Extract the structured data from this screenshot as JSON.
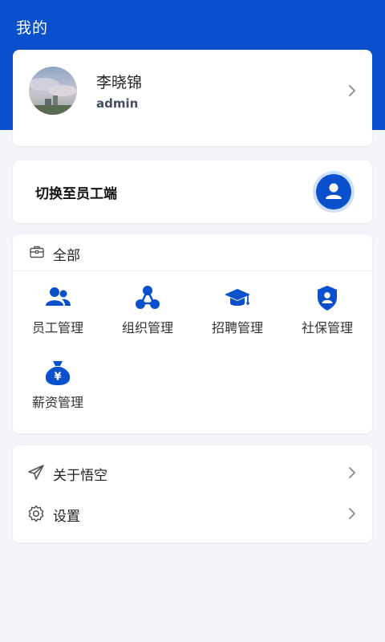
{
  "header": {
    "title": "我的",
    "background": "#0a4fcc"
  },
  "profile": {
    "name": "李晓锦",
    "account": "admin"
  },
  "switch": {
    "label": "切换至员工端"
  },
  "modules": {
    "title": "全部",
    "items": [
      {
        "label": "员工管理",
        "icon": "users-icon"
      },
      {
        "label": "组织管理",
        "icon": "org-structure-icon"
      },
      {
        "label": "招聘管理",
        "icon": "graduation-cap-icon"
      },
      {
        "label": "社保管理",
        "icon": "shield-user-icon"
      },
      {
        "label": "薪资管理",
        "icon": "money-bag-icon"
      }
    ]
  },
  "links": [
    {
      "label": "关于悟空",
      "icon": "paper-plane-icon"
    },
    {
      "label": "设置",
      "icon": "gear-icon"
    }
  ],
  "colors": {
    "accent": "#0a4fcc",
    "page_bg": "#f3f4f9"
  }
}
